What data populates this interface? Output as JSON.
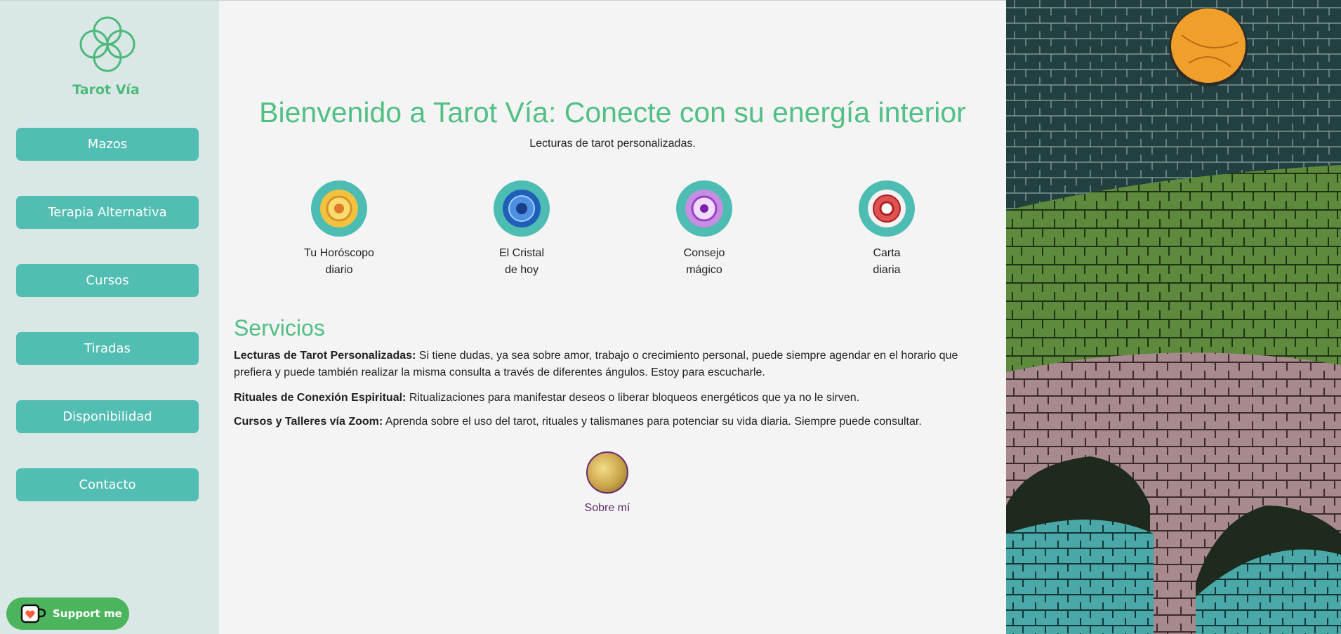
{
  "sidebar": {
    "brand": "Tarot Vía",
    "nav": [
      {
        "label": "Mazos"
      },
      {
        "label": "Terapia Alternativa"
      },
      {
        "label": "Cursos"
      },
      {
        "label": "Tiradas"
      },
      {
        "label": "Disponibilidad"
      },
      {
        "label": "Contacto"
      }
    ],
    "support_label": "Support me"
  },
  "main": {
    "title": "Bienvenido a Tarot Vía: Conecte con su energía interior",
    "subtitle": "Lecturas de tarot personalizadas.",
    "features": [
      {
        "line1": "Tu Horóscopo",
        "line2": "diario",
        "icon": "sun-mandala-icon"
      },
      {
        "line1": "El Cristal",
        "line2": "de hoy",
        "icon": "crystal-mandala-icon"
      },
      {
        "line1": "Consejo",
        "line2": "mágico",
        "icon": "magic-mandala-icon"
      },
      {
        "line1": "Carta",
        "line2": "diaria",
        "icon": "card-mandala-icon"
      }
    ],
    "services_title": "Servicios",
    "services": [
      {
        "title": "Lecturas de Tarot Personalizadas:",
        "text": " Si tiene dudas, ya sea sobre amor, trabajo o crecimiento personal, puede siempre agendar en el horario que prefiera y puede también realizar la misma consulta a través de diferentes ángulos. Estoy para escucharle."
      },
      {
        "title": "Rituales de Conexión Espiritual:",
        "text": " Ritualizaciones para manifestar deseos o liberar bloqueos energéticos que ya no le sirven."
      },
      {
        "title": "Cursos y Talleres vía Zoom:",
        "text": " Aprenda sobre el uso del tarot, rituales y talismanes para potenciar su vida diaria. Siempre puede consultar."
      }
    ],
    "about_label": "Sobre mí"
  },
  "colors": {
    "accent_green": "#52bf84",
    "nav_teal": "#52bdb2",
    "sidebar_bg": "#d9e8e6",
    "support_green": "#4cb45c",
    "about_purple": "#5b2a6a"
  }
}
